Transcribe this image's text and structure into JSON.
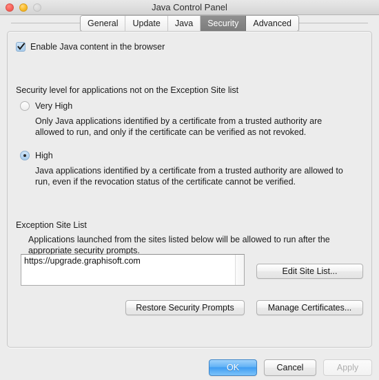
{
  "window": {
    "title": "Java Control Panel",
    "controls": {
      "close": "close-button",
      "minimize": "minimize-button",
      "zoom": "zoom-button"
    }
  },
  "tabs": [
    {
      "label": "General",
      "selected": false
    },
    {
      "label": "Update",
      "selected": false
    },
    {
      "label": "Java",
      "selected": false
    },
    {
      "label": "Security",
      "selected": true
    },
    {
      "label": "Advanced",
      "selected": false
    }
  ],
  "security": {
    "enable_checkbox": {
      "label": "Enable Java content in the browser",
      "checked": true
    },
    "level_heading": "Security level for applications not on the Exception Site list",
    "levels": [
      {
        "label": "Very High",
        "selected": false,
        "description": "Only Java applications identified by a certificate from a trusted authority are allowed to run, and only if the certificate can be verified as not revoked."
      },
      {
        "label": "High",
        "selected": true,
        "description": "Java applications identified by a certificate from a trusted authority are allowed to run, even if the revocation status of the certificate cannot be verified."
      }
    ],
    "exception_list": {
      "heading": "Exception Site List",
      "description": "Applications launched from the sites listed below will be allowed to run after the appropriate security prompts.",
      "sites": [
        "https://upgrade.graphisoft.com"
      ],
      "edit_button": "Edit Site List..."
    },
    "restore_button": "Restore Security Prompts",
    "certificates_button": "Manage Certificates..."
  },
  "footer": {
    "ok": "OK",
    "cancel": "Cancel",
    "apply": "Apply",
    "apply_disabled": true
  },
  "colors": {
    "window_background": "#ececec",
    "accent_blue": "#63b2f5",
    "selected_tab": "#7c7c7c",
    "close_light": "#fb6a62",
    "minimize_light": "#fdc132",
    "zoom_light": "#dcdcdc"
  }
}
